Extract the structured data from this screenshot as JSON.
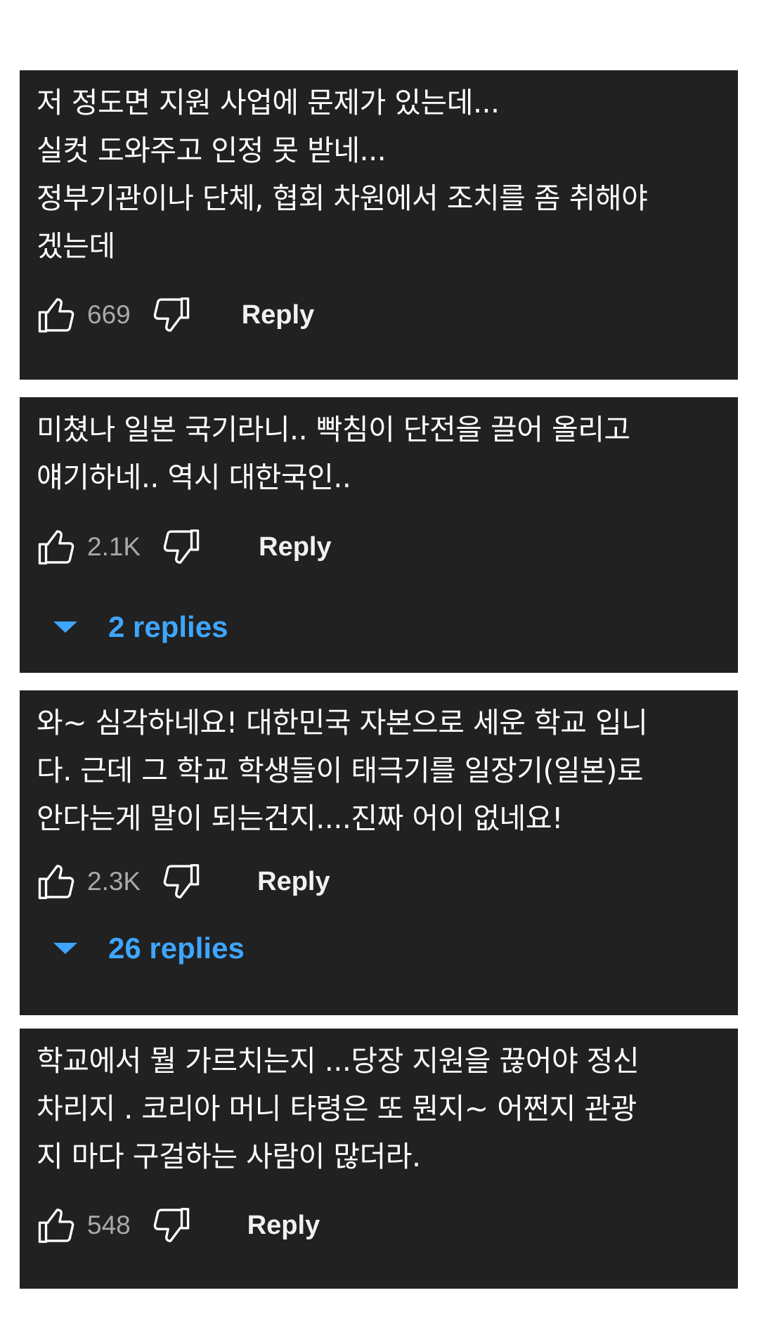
{
  "comments": [
    {
      "text": "저 정도면 지원 사업에 문제가 있는데...\n실컷 도와주고 인정 못 받네...\n정부기관이나 단체, 협회 차원에서 조치를 좀 취해야\n겠는데",
      "likes": "669",
      "reply_label": "Reply"
    },
    {
      "text": "미쳤나 일본 국기라니.. 빡침이 단전을 끌어 올리고\n얘기하네.. 역시 대한국인..",
      "likes": "2.1K",
      "reply_label": "Reply",
      "replies_label": "2 replies"
    },
    {
      "text": "와~ 심각하네요! 대한민국 자본으로 세운 학교 입니\n다. 근데 그 학교 학생들이 태극기를 일장기(일본)로\n안다는게 말이 되는건지....진짜 어이 없네요!",
      "likes": "2.3K",
      "reply_label": "Reply",
      "replies_label": "26 replies"
    },
    {
      "text": "학교에서 뭘 가르치는지 ...당장 지원을 끊어야 정신\n차리지 . 코리아 머니 타령은 또 뭔지~ 어쩐지 관광\n지  마다 구걸하는 사람이 많더라.",
      "likes": "548",
      "reply_label": "Reply"
    }
  ],
  "icons": {
    "like": "thumbs-up-icon",
    "dislike": "thumbs-down-icon",
    "expand": "caret-down-icon"
  },
  "colors": {
    "card_background": "#212121",
    "text": "#ffffff",
    "count": "#aaaaaa",
    "link": "#3ea6ff"
  }
}
